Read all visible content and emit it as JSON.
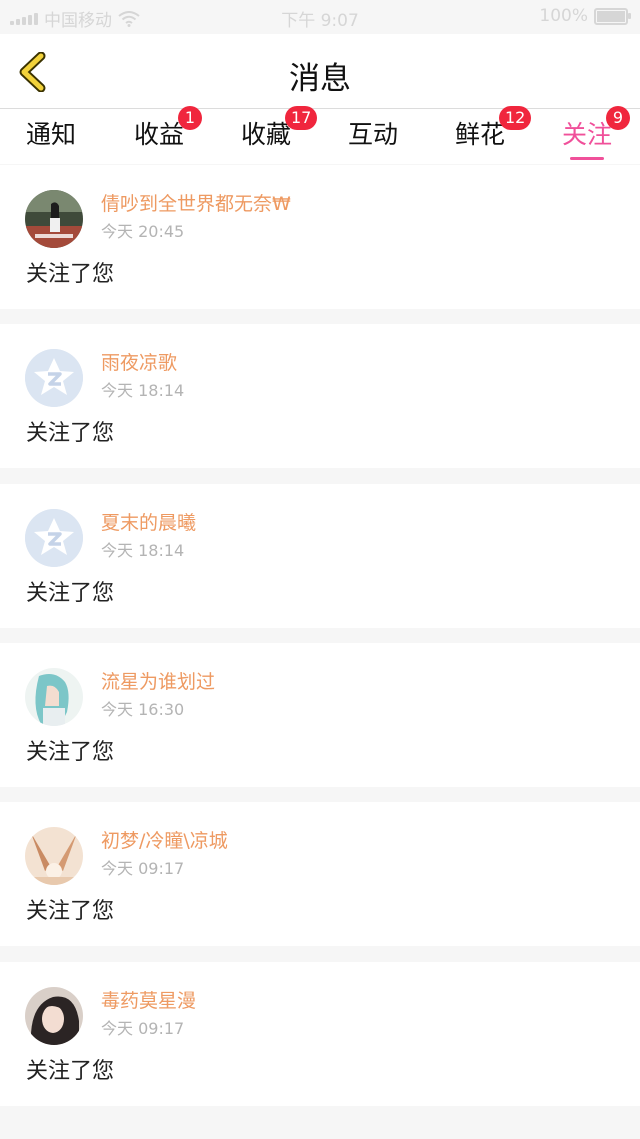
{
  "status_bar": {
    "carrier": "中国移动",
    "time": "下午 9:07",
    "battery": "100%"
  },
  "nav": {
    "title": "消息",
    "back_icon": "chevron-left-icon"
  },
  "tabs": [
    {
      "label": "通知",
      "badge": ""
    },
    {
      "label": "收益",
      "badge": "1"
    },
    {
      "label": "收藏",
      "badge": "17"
    },
    {
      "label": "互动",
      "badge": ""
    },
    {
      "label": "鲜花",
      "badge": "12"
    },
    {
      "label": "关注",
      "badge": "9",
      "active": true
    }
  ],
  "colors": {
    "accent": "#f0509a",
    "badge": "#f0263d",
    "username": "#ee9a62"
  },
  "items": [
    {
      "name": "倩吵到全世界都无奈₩",
      "time": "今天 20:45",
      "message": "关注了您",
      "avatar": "photo-avatar"
    },
    {
      "name": "雨夜凉歌",
      "time": "今天 18:14",
      "message": "关注了您",
      "avatar": "default-star-avatar"
    },
    {
      "name": "夏末的晨曦",
      "time": "今天 18:14",
      "message": "关注了您",
      "avatar": "default-star-avatar"
    },
    {
      "name": "流星为谁划过",
      "time": "今天 16:30",
      "message": "关注了您",
      "avatar": "anime-girl-avatar"
    },
    {
      "name": "初梦/冷瞳\\凉城",
      "time": "今天 09:17",
      "message": "关注了您",
      "avatar": "photo-avatar"
    },
    {
      "name": "毒药莫星漫",
      "time": "今天 09:17",
      "message": "关注了您",
      "avatar": "photo-avatar"
    }
  ]
}
